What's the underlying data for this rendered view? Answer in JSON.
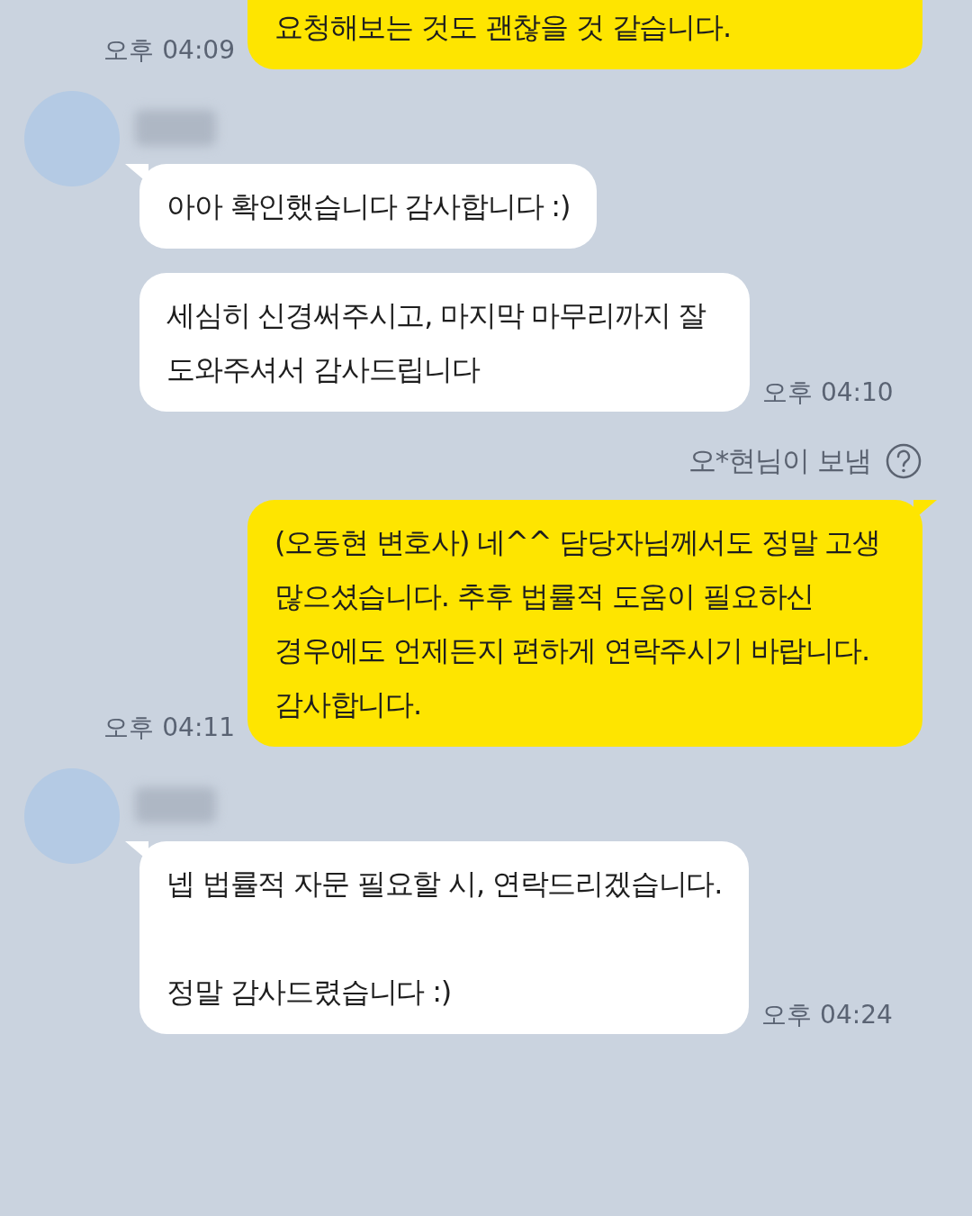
{
  "messages": [
    {
      "kind": "sent",
      "paragraphs": [
        "요청해보는 것도 괜찮을 것 같습니다."
      ],
      "time": "오후 04:09"
    },
    {
      "kind": "received",
      "first": true,
      "paragraphs": [
        "아아 확인했습니다 감사합니다 :)"
      ]
    },
    {
      "kind": "received",
      "first": false,
      "paragraphs": [
        "세심히 신경써주시고, 마지막 마무리까지 잘 도와주셔서 감사드립니다"
      ],
      "time": "오후 04:10"
    },
    {
      "kind": "notice",
      "text": "오*현님이 보냄"
    },
    {
      "kind": "sent",
      "paragraphs": [
        "(오동현 변호사) 네^^ 담당자님께서도 정말 고생 많으셨습니다. 추후 법률적 도움이 필요하신 경우에도 언제든지 편하게 연락주시기 바랍니다. 감사합니다."
      ],
      "time": "오후 04:11"
    },
    {
      "kind": "received",
      "first": true,
      "paragraphs": [
        "넵 법률적 자문 필요할 시, 연락드리겠습니다.",
        "정말 감사드렸습니다 :)"
      ],
      "time": "오후 04:24"
    }
  ]
}
